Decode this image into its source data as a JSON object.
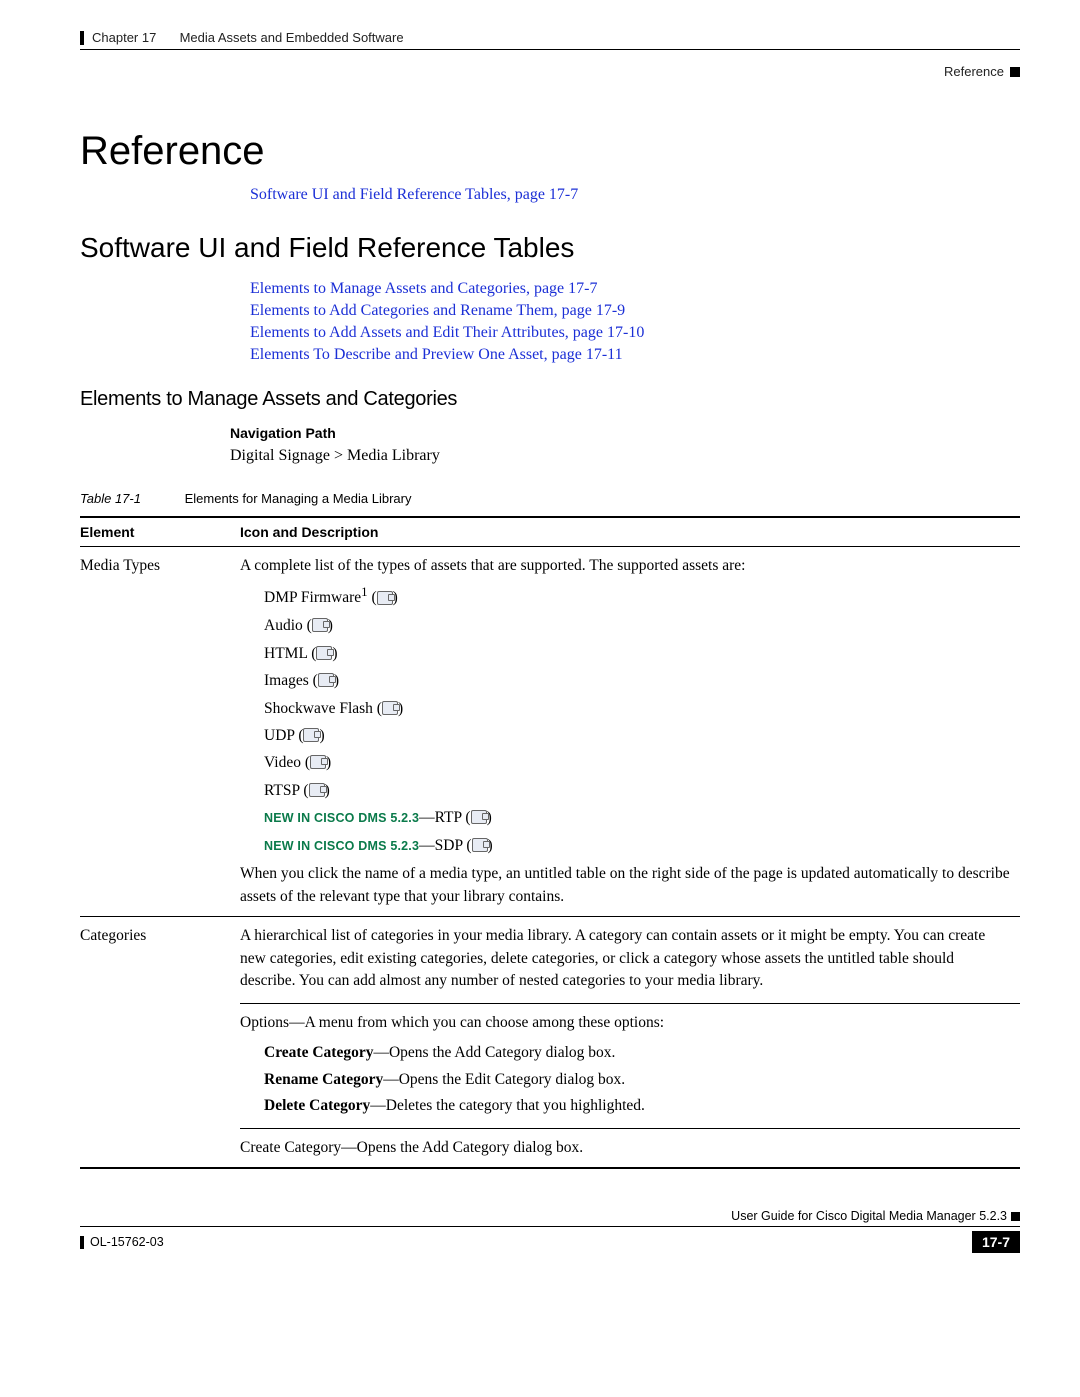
{
  "header": {
    "chapter_label": "Chapter 17",
    "chapter_title": "Media Assets and Embedded Software",
    "right_label": "Reference"
  },
  "h1": "Reference",
  "top_links": [
    "Software UI and Field Reference Tables, page 17-7"
  ],
  "h2": "Software UI and Field Reference Tables",
  "sub_links": [
    "Elements to Manage Assets and Categories, page 17-7",
    "Elements to Add Categories and Rename Them, page 17-9",
    "Elements to Add Assets and Edit Their Attributes, page 17-10",
    "Elements To Describe and Preview One Asset, page 17-11"
  ],
  "h3": "Elements to Manage Assets and Categories",
  "navpath": {
    "label": "Navigation Path",
    "value": "Digital Signage > Media Library"
  },
  "table_caption": {
    "num": "Table 17-1",
    "title": "Elements for Managing a Media Library"
  },
  "table_headers": {
    "c1": "Element",
    "c2": "Icon and Description"
  },
  "row_media": {
    "element": "Media Types",
    "intro": "A complete list of the types of assets that are supported. The supported assets are:",
    "assets": {
      "a0": "DMP Firmware",
      "a0_sup": "1",
      "a1": "Audio",
      "a2": "HTML",
      "a3": "Images",
      "a4": "Shockwave Flash",
      "a5": "UDP",
      "a6": "Video",
      "a7": "RTSP",
      "new_label": "NEW IN CISCO DMS 5.2.3",
      "a8": "RTP",
      "a9": "SDP"
    },
    "outro": "When you click the name of a media type, an untitled table on the right side of the page is updated automatically to describe assets of the relevant type that your library contains."
  },
  "row_cat": {
    "element": "Categories",
    "para": "A hierarchical list of categories in your media library. A category can contain assets or it might be empty. You can create new categories, edit existing categories, delete categories, or click a category whose assets the untitled table should describe. You can add almost any number of nested categories to your media library.",
    "options_intro": "Options—A menu from which you can choose among these options:",
    "opt1_b": "Create Category",
    "opt1_t": "—Opens the Add Category dialog box.",
    "opt2_b": "Rename Category",
    "opt2_t": "—Opens the Edit Category dialog box.",
    "opt3_b": "Delete Category",
    "opt3_t": "—Deletes the category that you highlighted.",
    "last": "Create Category—Opens the Add Category dialog box."
  },
  "footer": {
    "guide": "User Guide for Cisco Digital Media Manager 5.2.3",
    "docnum": "OL-15762-03",
    "page": "17-7"
  }
}
